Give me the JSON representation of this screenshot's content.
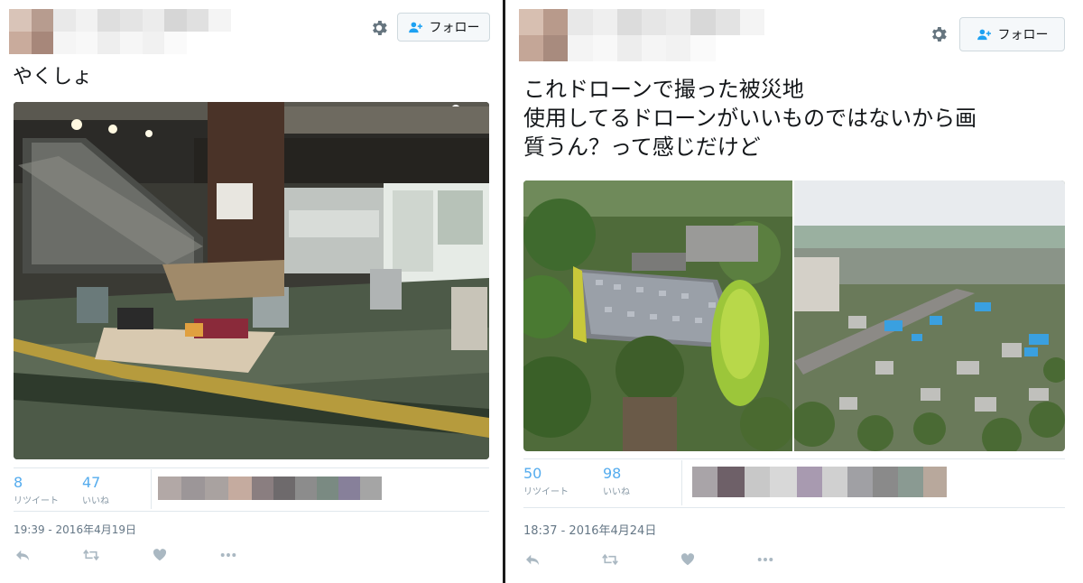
{
  "tweet_left": {
    "follow_label": "フォロー",
    "text_lines": [
      "やくしょ"
    ],
    "retweets_count": "8",
    "retweets_label": "リツイート",
    "likes_count": "47",
    "likes_label": "いいね",
    "timestamp": "19:39 - 2016年4月19日",
    "image_description_icon": "photo-hall"
  },
  "tweet_right": {
    "follow_label": "フォロー",
    "text_lines": [
      "これドローンで撮った被災地",
      "使用してるドローンがいいものではないから画",
      "質うん？って感じだけど"
    ],
    "retweets_count": "50",
    "retweets_label": "リツイート",
    "likes_count": "98",
    "likes_label": "いいね",
    "timestamp": "18:37 - 2016年4月24日"
  },
  "icons": {
    "settings": "gear-icon",
    "follow": "add-person-icon",
    "reply": "reply-icon",
    "retweet": "retweet-icon",
    "like": "heart-icon",
    "more": "more-icon"
  },
  "colors": {
    "link_blue": "#55acee",
    "muted": "#8899a6",
    "action_gray": "#aab8c2"
  }
}
